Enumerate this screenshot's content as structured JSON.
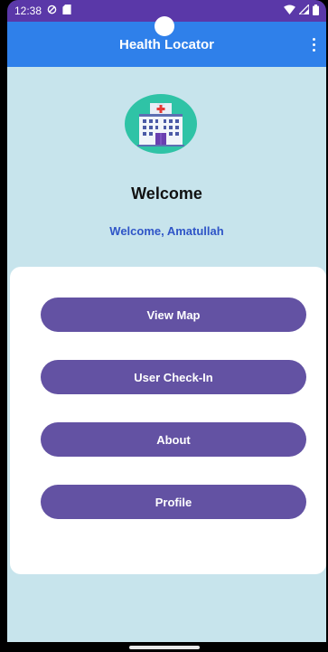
{
  "status_bar": {
    "time": "12:38"
  },
  "app_bar": {
    "title": "Health Locator"
  },
  "welcome": {
    "title": "Welcome",
    "subtitle": "Welcome, Amatullah"
  },
  "menu": {
    "items": [
      {
        "label": "View Map"
      },
      {
        "label": "User Check-In"
      },
      {
        "label": "About"
      },
      {
        "label": "Profile"
      }
    ]
  },
  "colors": {
    "status_bar": "#5a38a8",
    "app_bar": "#2f80ea",
    "background": "#c7e4ec",
    "button": "#6352a3",
    "subtitle": "#2f55c7",
    "logo_circle": "#2fc3a6"
  },
  "icons": {
    "status": [
      "do-not-disturb-icon",
      "sd-card-icon",
      "wifi-icon",
      "signal-icon",
      "battery-icon"
    ],
    "app_bar": "more-vert-icon",
    "logo": "hospital-icon"
  }
}
